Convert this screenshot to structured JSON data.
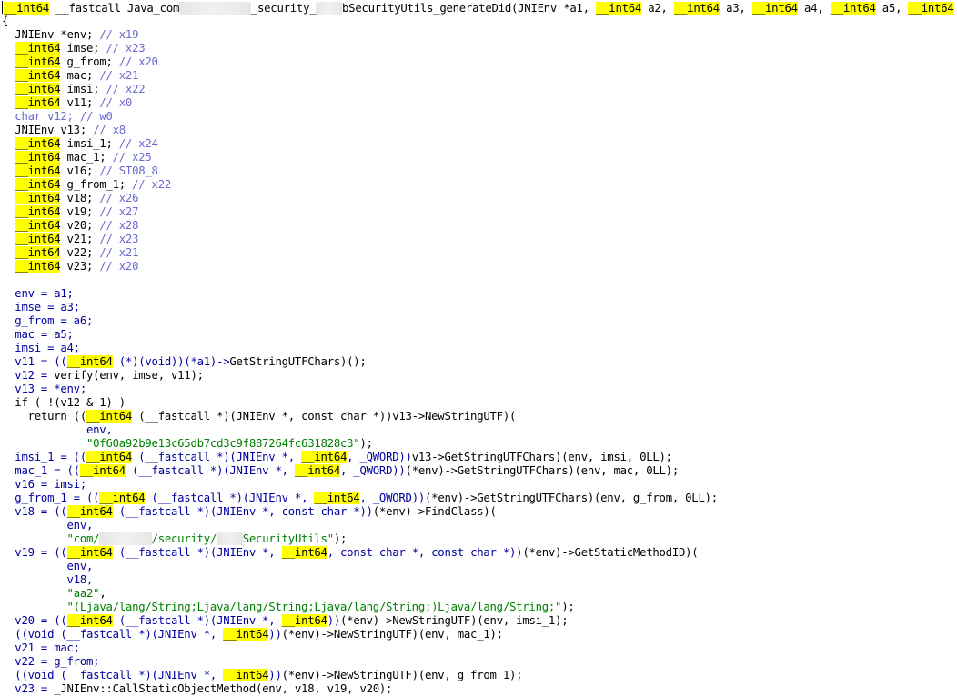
{
  "editor": {
    "lines": [
      {
        "tokens": [
          {
            "t": "cursor"
          },
          {
            "t": "hl",
            "v": "__int64"
          },
          {
            "t": "kw",
            "v": " __fastcall Java_com"
          },
          {
            "t": "blur",
            "v": "_xxxxx_xxxx"
          },
          {
            "t": "kw",
            "v": "_security_"
          },
          {
            "t": "blur",
            "v": "xxxx"
          },
          {
            "t": "kw",
            "v": "bSecurityUtils_generateDid(JNIEnv *a1, "
          },
          {
            "t": "hl",
            "v": "__int64"
          },
          {
            "t": "kw",
            "v": " a2, "
          },
          {
            "t": "hl",
            "v": "__int64"
          },
          {
            "t": "kw",
            "v": " a3, "
          },
          {
            "t": "hl",
            "v": "__int64"
          },
          {
            "t": "kw",
            "v": " a4, "
          },
          {
            "t": "hl",
            "v": "__int64"
          },
          {
            "t": "kw",
            "v": " a5, "
          },
          {
            "t": "hl",
            "v": "__int64"
          },
          {
            "t": "kw",
            "v": " a6)"
          }
        ]
      },
      {
        "tokens": [
          {
            "t": "kw",
            "v": "{"
          }
        ]
      },
      {
        "tokens": [
          {
            "t": "kw",
            "v": "  JNIEnv *env; "
          },
          {
            "t": "cm",
            "v": "// x19"
          }
        ]
      },
      {
        "tokens": [
          {
            "t": "kw",
            "v": "  "
          },
          {
            "t": "hl",
            "v": "__int64"
          },
          {
            "t": "kw",
            "v": " imse; "
          },
          {
            "t": "cm",
            "v": "// x23"
          }
        ]
      },
      {
        "tokens": [
          {
            "t": "kw",
            "v": "  "
          },
          {
            "t": "hl",
            "v": "__int64"
          },
          {
            "t": "kw",
            "v": " g_from; "
          },
          {
            "t": "cm",
            "v": "// x20"
          }
        ]
      },
      {
        "tokens": [
          {
            "t": "kw",
            "v": "  "
          },
          {
            "t": "hl",
            "v": "__int64"
          },
          {
            "t": "kw",
            "v": " mac; "
          },
          {
            "t": "cm",
            "v": "// x21"
          }
        ]
      },
      {
        "tokens": [
          {
            "t": "kw",
            "v": "  "
          },
          {
            "t": "hl",
            "v": "__int64"
          },
          {
            "t": "kw",
            "v": " imsi; "
          },
          {
            "t": "cm",
            "v": "// x22"
          }
        ]
      },
      {
        "tokens": [
          {
            "t": "kw",
            "v": "  "
          },
          {
            "t": "hl",
            "v": "__int64"
          },
          {
            "t": "kw",
            "v": " v11; "
          },
          {
            "t": "cm",
            "v": "// x0"
          }
        ]
      },
      {
        "tokens": [
          {
            "t": "cm",
            "v": "  char v12; // w0"
          }
        ]
      },
      {
        "tokens": [
          {
            "t": "kw",
            "v": "  JNIEnv v13; "
          },
          {
            "t": "cm",
            "v": "// x8"
          }
        ]
      },
      {
        "tokens": [
          {
            "t": "kw",
            "v": "  "
          },
          {
            "t": "hl",
            "v": "__int64"
          },
          {
            "t": "kw",
            "v": " imsi_1; "
          },
          {
            "t": "cm",
            "v": "// x24"
          }
        ]
      },
      {
        "tokens": [
          {
            "t": "kw",
            "v": "  "
          },
          {
            "t": "hl",
            "v": "__int64"
          },
          {
            "t": "kw",
            "v": " mac_1; "
          },
          {
            "t": "cm",
            "v": "// x25"
          }
        ]
      },
      {
        "tokens": [
          {
            "t": "kw",
            "v": "  "
          },
          {
            "t": "hl",
            "v": "__int64"
          },
          {
            "t": "kw",
            "v": " v16; "
          },
          {
            "t": "cm",
            "v": "// ST08_8"
          }
        ]
      },
      {
        "tokens": [
          {
            "t": "kw",
            "v": "  "
          },
          {
            "t": "hl",
            "v": "__int64"
          },
          {
            "t": "kw",
            "v": " g_from_1; "
          },
          {
            "t": "cm",
            "v": "// x22"
          }
        ]
      },
      {
        "tokens": [
          {
            "t": "kw",
            "v": "  "
          },
          {
            "t": "hl",
            "v": "__int64"
          },
          {
            "t": "kw",
            "v": " v18; "
          },
          {
            "t": "cm",
            "v": "// x26"
          }
        ]
      },
      {
        "tokens": [
          {
            "t": "kw",
            "v": "  "
          },
          {
            "t": "hl",
            "v": "__int64"
          },
          {
            "t": "kw",
            "v": " v19; "
          },
          {
            "t": "cm",
            "v": "// x27"
          }
        ]
      },
      {
        "tokens": [
          {
            "t": "kw",
            "v": "  "
          },
          {
            "t": "hl",
            "v": "__int64"
          },
          {
            "t": "kw",
            "v": " v20; "
          },
          {
            "t": "cm",
            "v": "// x28"
          }
        ]
      },
      {
        "tokens": [
          {
            "t": "kw",
            "v": "  "
          },
          {
            "t": "hl",
            "v": "__int64"
          },
          {
            "t": "kw",
            "v": " v21; "
          },
          {
            "t": "cm",
            "v": "// x23"
          }
        ]
      },
      {
        "tokens": [
          {
            "t": "kw",
            "v": "  "
          },
          {
            "t": "hl",
            "v": "__int64"
          },
          {
            "t": "kw",
            "v": " v22; "
          },
          {
            "t": "cm",
            "v": "// x21"
          }
        ]
      },
      {
        "tokens": [
          {
            "t": "kw",
            "v": "  "
          },
          {
            "t": "hl",
            "v": "__int64"
          },
          {
            "t": "kw",
            "v": " v23; "
          },
          {
            "t": "cm",
            "v": "// x20"
          }
        ]
      },
      {
        "tokens": []
      },
      {
        "tokens": [
          {
            "t": "var",
            "v": "  env = a1;"
          }
        ]
      },
      {
        "tokens": [
          {
            "t": "var",
            "v": "  imse = a3;"
          }
        ]
      },
      {
        "tokens": [
          {
            "t": "var",
            "v": "  g_from = a6;"
          }
        ]
      },
      {
        "tokens": [
          {
            "t": "var",
            "v": "  mac = a5;"
          }
        ]
      },
      {
        "tokens": [
          {
            "t": "var",
            "v": "  imsi = a4;"
          }
        ]
      },
      {
        "tokens": [
          {
            "t": "var",
            "v": "  v11 = (("
          },
          {
            "t": "hl",
            "v": "__int64"
          },
          {
            "t": "var",
            "v": " (*)(void))(*a1)->"
          },
          {
            "t": "kw",
            "v": "GetStringUTFChars)();"
          }
        ]
      },
      {
        "tokens": [
          {
            "t": "var",
            "v": "  v12 = "
          },
          {
            "t": "kw",
            "v": "verify(env, imse, v11);"
          }
        ]
      },
      {
        "tokens": [
          {
            "t": "var",
            "v": "  v13 = *env;"
          }
        ]
      },
      {
        "tokens": [
          {
            "t": "kw",
            "v": "  if ( !(v12 & 1) )"
          }
        ]
      },
      {
        "tokens": [
          {
            "t": "kw",
            "v": "    return (("
          },
          {
            "t": "hl",
            "v": "__int64"
          },
          {
            "t": "kw",
            "v": " (__fastcall *)(JNIEnv *, const char *))v13->NewStringUTF)("
          }
        ]
      },
      {
        "tokens": [
          {
            "t": "var",
            "v": "             env,"
          }
        ]
      },
      {
        "tokens": [
          {
            "t": "kw",
            "v": "             "
          },
          {
            "t": "str",
            "v": "\"0f60a92b9e13c65db7cd3c9f887264fc631828c3\""
          },
          {
            "t": "kw",
            "v": ");"
          }
        ]
      },
      {
        "tokens": [
          {
            "t": "var",
            "v": "  imsi_1 = (("
          },
          {
            "t": "hl",
            "v": "__int64"
          },
          {
            "t": "var",
            "v": " (__fastcall *)(JNIEnv *, "
          },
          {
            "t": "hl",
            "v": "__int64"
          },
          {
            "t": "var",
            "v": ", _QWORD))"
          },
          {
            "t": "kw",
            "v": "v13->GetStringUTFChars)(env, imsi, 0LL);"
          }
        ]
      },
      {
        "tokens": [
          {
            "t": "var",
            "v": "  mac_1 = (("
          },
          {
            "t": "hl",
            "v": "__int64"
          },
          {
            "t": "var",
            "v": " (__fastcall *)(JNIEnv *, "
          },
          {
            "t": "hl",
            "v": "__int64"
          },
          {
            "t": "var",
            "v": ", _QWORD))"
          },
          {
            "t": "kw",
            "v": "(*env)->GetStringUTFChars)(env, mac, 0LL);"
          }
        ]
      },
      {
        "tokens": [
          {
            "t": "var",
            "v": "  v16 = imsi;"
          }
        ]
      },
      {
        "tokens": [
          {
            "t": "var",
            "v": "  g_from_1 = (("
          },
          {
            "t": "hl",
            "v": "__int64"
          },
          {
            "t": "var",
            "v": " (__fastcall *)(JNIEnv *, "
          },
          {
            "t": "hl",
            "v": "__int64"
          },
          {
            "t": "var",
            "v": ", _QWORD))"
          },
          {
            "t": "kw",
            "v": "(*env)->GetStringUTFChars)(env, g_from, 0LL);"
          }
        ]
      },
      {
        "tokens": [
          {
            "t": "var",
            "v": "  v18 = (("
          },
          {
            "t": "hl",
            "v": "__int64"
          },
          {
            "t": "var",
            "v": " (__fastcall *)(JNIEnv *, const char *))"
          },
          {
            "t": "kw",
            "v": "(*env)->FindClass)("
          }
        ]
      },
      {
        "tokens": [
          {
            "t": "var",
            "v": "          env,"
          }
        ]
      },
      {
        "tokens": [
          {
            "t": "kw",
            "v": "          "
          },
          {
            "t": "str",
            "v": "\"com/"
          },
          {
            "t": "blur",
            "v": "xxxxxxxx"
          },
          {
            "t": "str",
            "v": "/security/"
          },
          {
            "t": "blur",
            "v": "xxxx"
          },
          {
            "t": "str",
            "v": "SecurityUtils\""
          },
          {
            "t": "kw",
            "v": ");"
          }
        ]
      },
      {
        "tokens": [
          {
            "t": "var",
            "v": "  v19 = (("
          },
          {
            "t": "hl",
            "v": "__int64"
          },
          {
            "t": "var",
            "v": " (__fastcall *)(JNIEnv *, "
          },
          {
            "t": "hl",
            "v": "__int64"
          },
          {
            "t": "var",
            "v": ", const char *, const char *))"
          },
          {
            "t": "kw",
            "v": "(*env)->GetStaticMethodID)("
          }
        ]
      },
      {
        "tokens": [
          {
            "t": "var",
            "v": "          env,"
          }
        ]
      },
      {
        "tokens": [
          {
            "t": "var",
            "v": "          v18,"
          }
        ]
      },
      {
        "tokens": [
          {
            "t": "kw",
            "v": "          "
          },
          {
            "t": "str",
            "v": "\"aa2\""
          },
          {
            "t": "kw",
            "v": ","
          }
        ]
      },
      {
        "tokens": [
          {
            "t": "kw",
            "v": "          "
          },
          {
            "t": "str",
            "v": "\"(Ljava/lang/String;Ljava/lang/String;Ljava/lang/String;)Ljava/lang/String;\""
          },
          {
            "t": "kw",
            "v": ");"
          }
        ]
      },
      {
        "tokens": [
          {
            "t": "var",
            "v": "  v20 = (("
          },
          {
            "t": "hl",
            "v": "__int64"
          },
          {
            "t": "var",
            "v": " (__fastcall *)(JNIEnv *, "
          },
          {
            "t": "hl",
            "v": "__int64"
          },
          {
            "t": "var",
            "v": "))"
          },
          {
            "t": "kw",
            "v": "(*env)->NewStringUTF)(env, imsi_1);"
          }
        ]
      },
      {
        "tokens": [
          {
            "t": "var",
            "v": "  ((void (__fastcall *)(JNIEnv *, "
          },
          {
            "t": "hl",
            "v": "__int64"
          },
          {
            "t": "var",
            "v": "))"
          },
          {
            "t": "kw",
            "v": "(*env)->NewStringUTF)(env, mac_1);"
          }
        ]
      },
      {
        "tokens": [
          {
            "t": "var",
            "v": "  v21 = mac;"
          }
        ]
      },
      {
        "tokens": [
          {
            "t": "var",
            "v": "  v22 = g_from;"
          }
        ]
      },
      {
        "tokens": [
          {
            "t": "var",
            "v": "  ((void (__fastcall *)(JNIEnv *, "
          },
          {
            "t": "hl",
            "v": "__int64"
          },
          {
            "t": "var",
            "v": "))"
          },
          {
            "t": "kw",
            "v": "(*env)->NewStringUTF)(env, g_from_1);"
          }
        ]
      },
      {
        "tokens": [
          {
            "t": "var",
            "v": "  v23 = "
          },
          {
            "t": "kw",
            "v": "_JNIEnv::CallStaticObjectMethod(env, v18, v19, v20);"
          }
        ]
      }
    ]
  }
}
